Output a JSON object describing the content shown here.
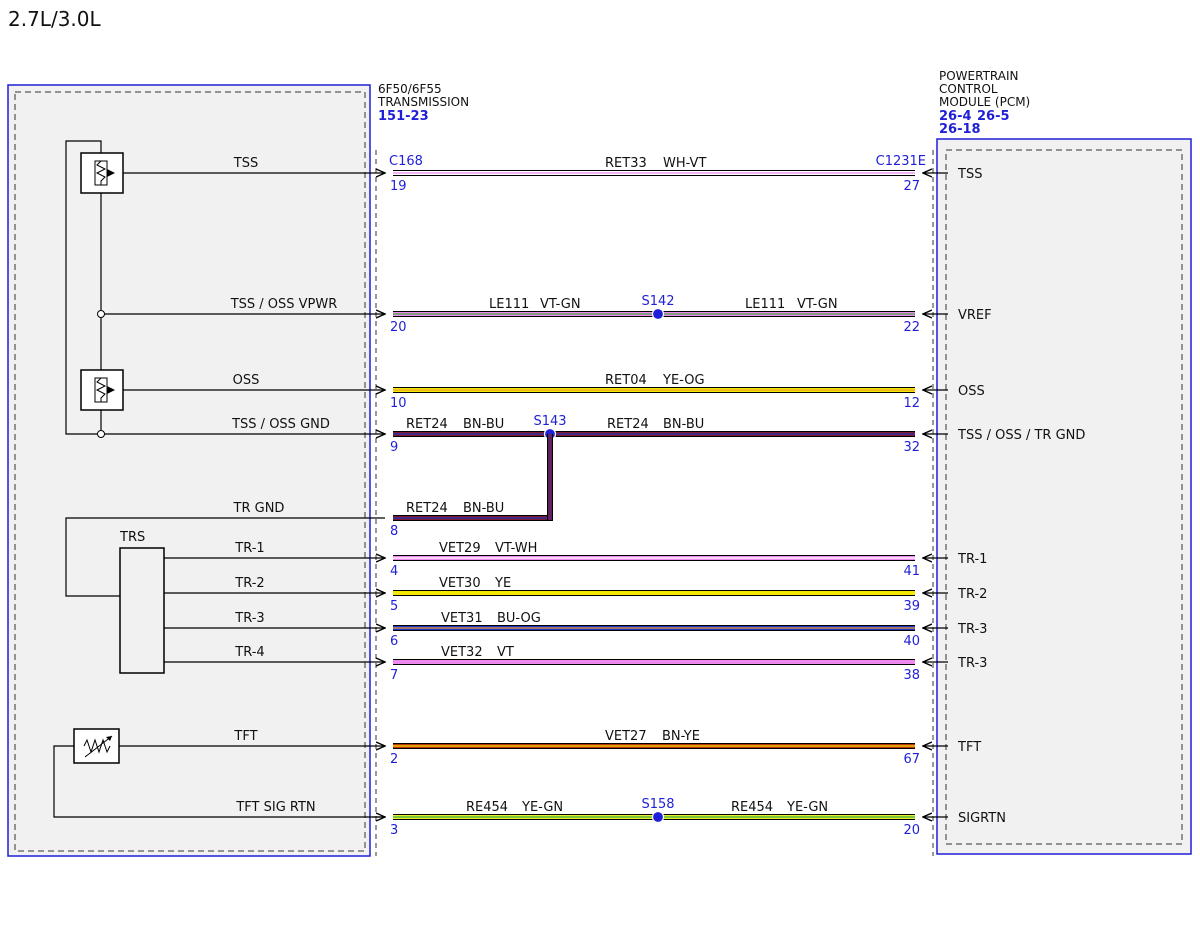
{
  "title": "2.7L/3.0L",
  "colors": {
    "blue": "#1f1fd8",
    "frame_fill": "#f1f1f1",
    "WH": "#ffffff",
    "VT": "#ee88ee",
    "GN": "#3fae3f",
    "YE": "#f4e800",
    "OG": "#f0a030",
    "BN": "#7a1a28",
    "BU": "#2233cc",
    "BN-YE-base": "#b8350e",
    "YE-GN-base": "#e7ef2e"
  },
  "transmission": {
    "model": "6F50/6F55",
    "name": "TRANSMISSION",
    "ref": "151-23",
    "connector": "C168"
  },
  "pcm": {
    "line1": "POWERTRAIN",
    "line2": "CONTROL",
    "line3": "MODULE (PCM)",
    "ref1": "26-4",
    "ref2": "26-5",
    "ref3": "26-18",
    "connector": "C1231E"
  },
  "components": {
    "trs": "TRS"
  },
  "circuits": [
    {
      "left_label": "TSS",
      "pin_left": "19",
      "pin_right": "27",
      "right_label": "TSS",
      "segments": [
        {
          "circuit": "RET33",
          "color_name": "WH-VT"
        }
      ],
      "splice": "",
      "base": "WH",
      "stripe": "VT"
    },
    {
      "left_label": "TSS / OSS VPWR",
      "pin_left": "20",
      "pin_right": "22",
      "right_label": "VREF",
      "segments": [
        {
          "circuit": "LE111",
          "color_name": "VT-GN"
        },
        {
          "circuit": "LE111",
          "color_name": "VT-GN"
        }
      ],
      "splice": "S142",
      "base": "VT",
      "stripe": "GN"
    },
    {
      "left_label": "OSS",
      "pin_left": "10",
      "pin_right": "12",
      "right_label": "OSS",
      "segments": [
        {
          "circuit": "RET04",
          "color_name": "YE-OG"
        }
      ],
      "splice": "",
      "base": "YE",
      "stripe": "OG"
    },
    {
      "left_label": "TSS / OSS GND",
      "pin_left": "9",
      "pin_right": "32",
      "right_label": "TSS / OSS / TR GND",
      "segments": [
        {
          "circuit": "RET24",
          "color_name": "BN-BU"
        },
        {
          "circuit": "RET24",
          "color_name": "BN-BU"
        }
      ],
      "splice": "S143",
      "base": "BN",
      "stripe": "BU"
    },
    {
      "left_label": "TR GND",
      "pin_left": "8",
      "pin_right": "",
      "right_label": "",
      "segments": [
        {
          "circuit": "RET24",
          "color_name": "BN-BU"
        }
      ],
      "splice": "",
      "base": "BN",
      "stripe": "BU"
    },
    {
      "left_label": "TR-1",
      "pin_left": "4",
      "pin_right": "41",
      "right_label": "TR-1",
      "segments": [
        {
          "circuit": "VET29",
          "color_name": "VT-WH"
        }
      ],
      "splice": "",
      "base": "VT",
      "stripe": "WH"
    },
    {
      "left_label": "TR-2",
      "pin_left": "5",
      "pin_right": "39",
      "right_label": "TR-2",
      "segments": [
        {
          "circuit": "VET30",
          "color_name": "YE"
        }
      ],
      "splice": "",
      "base": "YE",
      "stripe": ""
    },
    {
      "left_label": "TR-3",
      "pin_left": "6",
      "pin_right": "40",
      "right_label": "TR-3",
      "segments": [
        {
          "circuit": "VET31",
          "color_name": "BU-OG"
        }
      ],
      "splice": "",
      "base": "BU",
      "stripe": "OG"
    },
    {
      "left_label": "TR-4",
      "pin_left": "7",
      "pin_right": "38",
      "right_label": "TR-3",
      "segments": [
        {
          "circuit": "VET32",
          "color_name": "VT"
        }
      ],
      "splice": "",
      "base": "VT",
      "stripe": ""
    },
    {
      "left_label": "TFT",
      "pin_left": "2",
      "pin_right": "67",
      "right_label": "TFT",
      "segments": [
        {
          "circuit": "VET27",
          "color_name": "BN-YE"
        }
      ],
      "splice": "",
      "base": "BN-YE-base",
      "stripe": "YE"
    },
    {
      "left_label": "TFT SIG RTN",
      "pin_left": "3",
      "pin_right": "20",
      "right_label": "SIGRTN",
      "segments": [
        {
          "circuit": "RE454",
          "color_name": "YE-GN"
        },
        {
          "circuit": "RE454",
          "color_name": "YE-GN"
        }
      ],
      "splice": "S158",
      "base": "YE-GN-base",
      "stripe": "GN"
    }
  ]
}
